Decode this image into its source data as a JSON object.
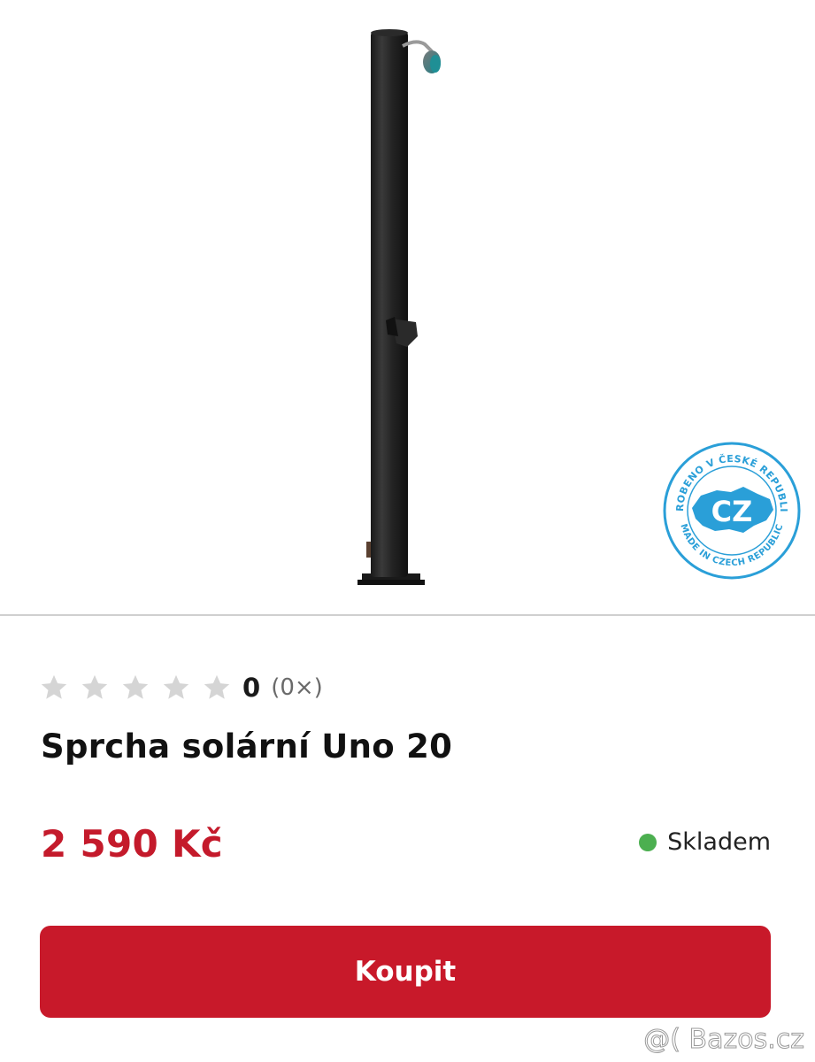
{
  "product": {
    "image_alt": "Sprcha solární Uno 20",
    "badge": {
      "center_text": "CZ",
      "ring_top_text": "VYROBENO V ČESKÉ REPUBLICE",
      "ring_bottom_text": "MADE IN CZECH REPUBLIC",
      "color": "#2a9fd8"
    },
    "rating": {
      "stars_total": 5,
      "stars_filled": 0,
      "value": "0",
      "count": "(0×)",
      "star_color": "#d5d5d5"
    },
    "title": "Sprcha solární Uno 20",
    "price": "2 590 Kč",
    "price_color": "#c41a2b",
    "stock": {
      "label": "Skladem",
      "dot_color": "#4caf50"
    },
    "buy_button": {
      "label": "Koupit",
      "color": "#c8192a"
    }
  },
  "watermark": "@( Bazos.cz"
}
